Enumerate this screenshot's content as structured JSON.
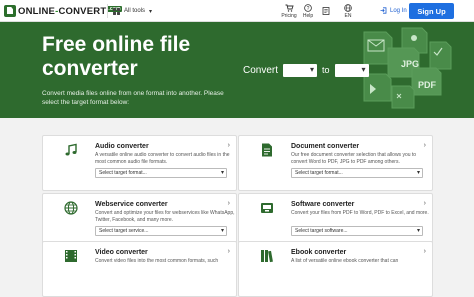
{
  "header": {
    "logo_text_a": "ONLINE",
    "logo_text_dash": "-",
    "logo_text_b": "CONVERT",
    "logo_dotcom": ".com",
    "all_tools": "All tools",
    "pricing": "Pricing",
    "help": "Help",
    "lang": "EN",
    "login": "Log In",
    "signup": "Sign Up"
  },
  "hero": {
    "title": "Free online file converter",
    "subtitle": "Convert media files online from one format into another. Please select the target format below:",
    "convert_label": "Convert",
    "to_label": "to",
    "deco_labels": [
      "JPG",
      "PDF"
    ]
  },
  "cards": [
    {
      "title": "Audio converter",
      "desc": "A versatile online audio converter to convert audio files in the most common audio file formats.",
      "select": "Select target format...",
      "icon": "music-note-icon"
    },
    {
      "title": "Document converter",
      "desc": "Our free document converter selection that allows you to convert Word to PDF, JPG to PDF among others.",
      "select": "Select target format...",
      "icon": "document-icon"
    },
    {
      "title": "Webservice converter",
      "desc": "Convert and optimize your files for webservices like WhatsApp, Twitter, Facebook, and many more.",
      "select": "Select target service...",
      "icon": "globe-icon"
    },
    {
      "title": "Software converter",
      "desc": "Convert your files from PDF to Word, PDF to Excel, and more.",
      "select": "Select target software...",
      "icon": "software-icon"
    },
    {
      "title": "Video converter",
      "desc": "Convert video files into the most common formats, such",
      "select": "",
      "icon": "film-icon"
    },
    {
      "title": "Ebook converter",
      "desc": "A list of versatile online ebook converter that can",
      "select": "",
      "icon": "book-icon"
    }
  ],
  "colors": {
    "brand_green": "#2e6a2e",
    "signup_blue": "#1e6fe0",
    "login_blue": "#1e5fd0"
  }
}
